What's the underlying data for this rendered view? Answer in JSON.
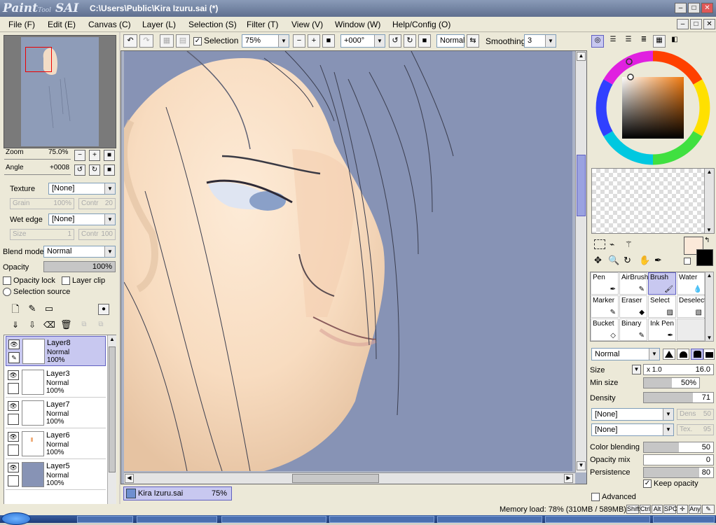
{
  "app": {
    "logo": "PaintTool SAI",
    "title": "C:\\Users\\Public\\Kira Izuru.sai (*)"
  },
  "menu": [
    "File (F)",
    "Edit (E)",
    "Canvas (C)",
    "Layer (L)",
    "Selection (S)",
    "Filter (T)",
    "View (V)",
    "Window (W)",
    "Help/Config (O)"
  ],
  "toolbar": {
    "selection_label": "Selection",
    "selection_checked": true,
    "zoom_value": "75%",
    "angle_value": "+000°",
    "mode_value": "Normal",
    "smoothing_label": "Smoothing",
    "smoothing_value": "3"
  },
  "navigator": {
    "zoom_label": "Zoom",
    "zoom_value": "75.0%",
    "angle_label": "Angle",
    "angle_value": "+0008"
  },
  "brush_options": {
    "texture_label": "Texture",
    "texture_value": "[None]",
    "grain_label": "Grain",
    "grain_value": "100%",
    "contr_label": "Contr",
    "contr_value": "20",
    "wetedge_label": "Wet edge",
    "wetedge_value": "[None]",
    "size_label": "Size",
    "size_value": "1",
    "contr2_label": "Contr",
    "contr2_value": "100"
  },
  "layer_options": {
    "blend_label": "Blend mode",
    "blend_value": "Normal",
    "opacity_label": "Opacity",
    "opacity_value": "100%",
    "opacity_fraction": 1.0,
    "opacity_lock": "Opacity lock",
    "layer_clip": "Layer clip",
    "selection_source": "Selection source"
  },
  "layers": [
    {
      "name": "Layer8",
      "mode": "Normal",
      "opacity": "100%",
      "selected": true
    },
    {
      "name": "Layer3",
      "mode": "Normal",
      "opacity": "100%",
      "selected": false
    },
    {
      "name": "Layer7",
      "mode": "Normal",
      "opacity": "100%",
      "selected": false
    },
    {
      "name": "Layer6",
      "mode": "Normal",
      "opacity": "100%",
      "selected": false
    },
    {
      "name": "Layer5",
      "mode": "Normal",
      "opacity": "100%",
      "selected": false
    }
  ],
  "doc_tab": {
    "name": "Kira Izuru.sai",
    "zoom": "75%"
  },
  "tools": {
    "row1": [
      "Pen",
      "AirBrush",
      "Brush",
      "Water"
    ],
    "row2": [
      "Marker",
      "Eraser",
      "Select",
      "Deselect"
    ],
    "row3": [
      "Bucket",
      "Binary",
      "Ink Pen",
      ""
    ],
    "active": "Brush"
  },
  "brush_settings": {
    "mode": "Normal",
    "size_label": "Size",
    "size_mult": "x 1.0",
    "size_value": "16.0",
    "minsize_label": "Min size",
    "minsize_value": "50%",
    "minsize_fraction": 0.5,
    "density_label": "Density",
    "density_value": "71",
    "density_fraction": 0.71,
    "none1": "[None]",
    "dens_label": "Dens",
    "dens_value": "50",
    "none2": "[None]",
    "tex_label": "Tex.",
    "tex_value": "95",
    "color_blending_label": "Color blending",
    "color_blending_value": "50",
    "color_blending_fraction": 0.5,
    "opacity_mix_label": "Opacity mix",
    "opacity_mix_value": "0",
    "opacity_mix_fraction": 0.0,
    "persistence_label": "Persistence",
    "persistence_value": "80",
    "persistence_fraction": 0.8,
    "keep_opacity_label": "Keep opacity",
    "advanced_label": "Advanced"
  },
  "colors": {
    "primary": "#fbe9d9",
    "secondary": "#000000",
    "accent": "#6060c0"
  },
  "status": {
    "memory": "Memory load: 78% (310MB / 589MB)",
    "keys": [
      "Shift",
      "Ctrl",
      "Alt",
      "SPC",
      "Any"
    ]
  }
}
